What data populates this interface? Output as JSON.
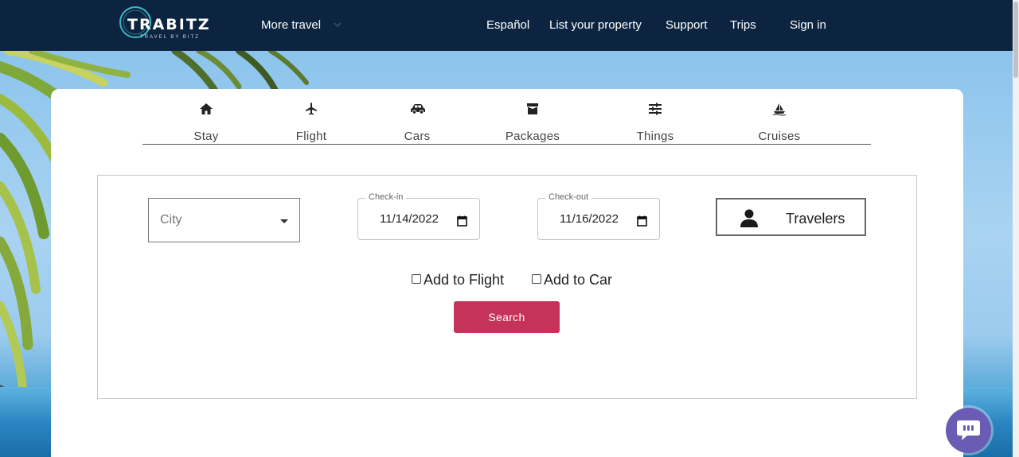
{
  "header": {
    "logo_text": "TRABITZ",
    "logo_sub": "TRAVEL BY BITZ",
    "more_travel": "More travel",
    "links": {
      "espanol": "Español",
      "list_property": "List your property",
      "support": "Support",
      "trips": "Trips",
      "sign_in": "Sign in"
    }
  },
  "tabs": [
    {
      "label": "Stay",
      "icon": "home-icon"
    },
    {
      "label": "Flight",
      "icon": "airplane-icon"
    },
    {
      "label": "Cars",
      "icon": "car-icon"
    },
    {
      "label": "Packages",
      "icon": "package-icon"
    },
    {
      "label": "Things",
      "icon": "sliders-icon"
    },
    {
      "label": "Cruises",
      "icon": "sailboat-icon"
    }
  ],
  "form": {
    "city_placeholder": "City",
    "checkin_label": "Check-in",
    "checkin_value": "11/14/2022",
    "checkout_label": "Check-out",
    "checkout_value": "11/16/2022",
    "travelers_label": "Travelers",
    "add_flight_label": "Add to Flight",
    "add_car_label": "Add to Car",
    "search_label": "Search"
  },
  "colors": {
    "header_bg": "#0d2440",
    "search_button": "#c5325a",
    "chat_bubble": "#6a5cb4"
  }
}
